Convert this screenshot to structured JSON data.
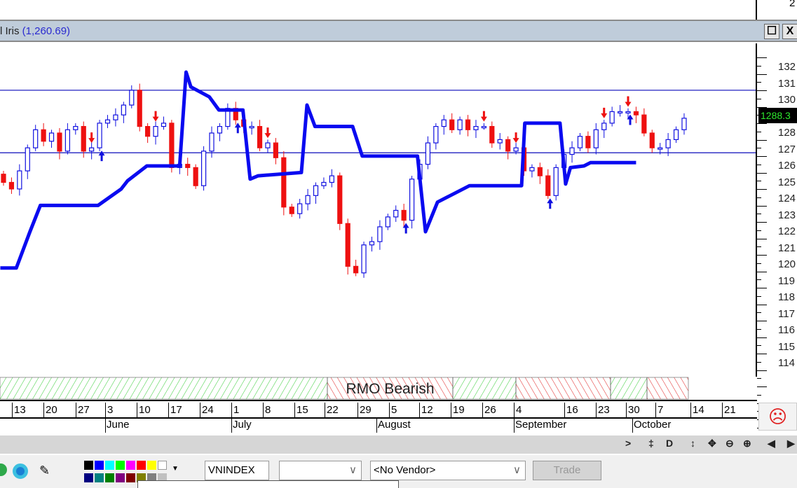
{
  "window": {
    "title": "l Iris",
    "title_value": "(1,260.69)",
    "maximize_label": "☐",
    "close_label": "X",
    "top_axis_fragment": "2"
  },
  "y_axis": {
    "labels": [
      "132",
      "131",
      "130",
      "128",
      "127",
      "126",
      "125",
      "124",
      "123",
      "122",
      "121",
      "120",
      "119",
      "118",
      "117",
      "116",
      "115",
      "114"
    ],
    "last_price": "1288.3"
  },
  "chart_data": {
    "type": "candlestick",
    "ylim": [
      1135,
      1330
    ],
    "closes": [
      1250,
      1246,
      1257,
      1271,
      1282,
      1275,
      1280,
      1269,
      1282,
      1284,
      1269,
      1271,
      1286,
      1288,
      1291,
      1297,
      1306,
      1284,
      1278,
      1284,
      1286,
      1259,
      1261,
      1259,
      1248,
      1269,
      1280,
      1284,
      1295,
      1288,
      1284,
      1284,
      1271,
      1274,
      1265,
      1235,
      1231,
      1237,
      1242,
      1248,
      1250,
      1254,
      1225,
      1199,
      1195,
      1212,
      1214,
      1223,
      1229,
      1233,
      1227,
      1252,
      1261,
      1274,
      1284,
      1288,
      1282,
      1288,
      1282,
      1284,
      1284,
      1274,
      1276,
      1269,
      1271,
      1257,
      1259,
      1254,
      1242,
      1259,
      1267,
      1271,
      1278,
      1271,
      1282,
      1286,
      1293,
      1293,
      1293,
      1291,
      1280,
      1271,
      1271,
      1276,
      1282,
      1289
    ],
    "first_close_open": 1255,
    "horizontal_lines": [
      1306,
      1268
    ],
    "stop_line": [
      [
        -0.4,
        1198
      ],
      [
        1.6,
        1198
      ],
      [
        3.3,
        1220
      ],
      [
        4.6,
        1236
      ],
      [
        11.8,
        1236
      ],
      [
        14.7,
        1246
      ],
      [
        15.5,
        1251
      ],
      [
        17.1,
        1257
      ],
      [
        17.9,
        1260
      ],
      [
        22,
        1260
      ],
      [
        22.8,
        1317
      ],
      [
        23.4,
        1308
      ],
      [
        25.7,
        1302
      ],
      [
        26.9,
        1294
      ],
      [
        29.9,
        1294
      ],
      [
        30.8,
        1252
      ],
      [
        31.8,
        1254
      ],
      [
        37.2,
        1256
      ],
      [
        37.9,
        1297
      ],
      [
        38.9,
        1284
      ],
      [
        43.6,
        1284
      ],
      [
        44.8,
        1266
      ],
      [
        51.7,
        1266
      ],
      [
        52.7,
        1220
      ],
      [
        54.2,
        1238
      ],
      [
        55.8,
        1242
      ],
      [
        58.2,
        1248
      ],
      [
        64.7,
        1248
      ],
      [
        65.1,
        1286
      ],
      [
        69.5,
        1286
      ],
      [
        70.2,
        1249
      ],
      [
        70.8,
        1259
      ],
      [
        72.5,
        1260
      ],
      [
        73.3,
        1262
      ],
      [
        79,
        1262
      ]
    ],
    "sell_arrows": [
      11,
      19,
      33,
      60,
      64,
      75,
      78
    ],
    "buy_arrows": [
      12,
      29,
      50,
      68,
      78
    ],
    "colors": {
      "up": "#1010e0",
      "down": "#ee1010",
      "stop_line": "#0a0af0",
      "hline": "#2020c0",
      "bull_band": "#33cc33",
      "bear_band": "#e02020"
    },
    "regime_bands": [
      {
        "state": "bullish",
        "label": ""
      },
      {
        "state": "bearish",
        "label": "RMO Bearish"
      },
      {
        "state": "bullish",
        "label": ""
      },
      {
        "state": "bearish",
        "label": ""
      },
      {
        "state": "bullish",
        "label": ""
      },
      {
        "state": "bearish",
        "label": ""
      }
    ]
  },
  "date_axis": {
    "days": [
      "13",
      "20",
      "27",
      "3",
      "10",
      "17",
      "24",
      "1",
      "8",
      "15",
      "22",
      "29",
      "5",
      "12",
      "19",
      "26",
      "4",
      "16",
      "23",
      "30",
      "7",
      "14",
      "21"
    ],
    "months": [
      "June",
      "July",
      "August",
      "September",
      "October"
    ]
  },
  "nav": {
    "items": [
      ">",
      "‡",
      "D",
      "↕",
      "✥",
      "⊖",
      "⊕",
      "◀",
      "▶"
    ]
  },
  "toolbar": {
    "symbol": "VNINDEX",
    "dropdown1": "",
    "vendor": "<No Vendor>",
    "trade_label": "Trade",
    "palette": [
      "#000000",
      "#0000ff",
      "#00ffff",
      "#00ff00",
      "#ff00ff",
      "#ff0000",
      "#ffff00",
      "#ffffff",
      "#000080",
      "#008080",
      "#008000",
      "#800080",
      "#800000",
      "#808000",
      "#808080",
      "#c0c0c0"
    ]
  }
}
